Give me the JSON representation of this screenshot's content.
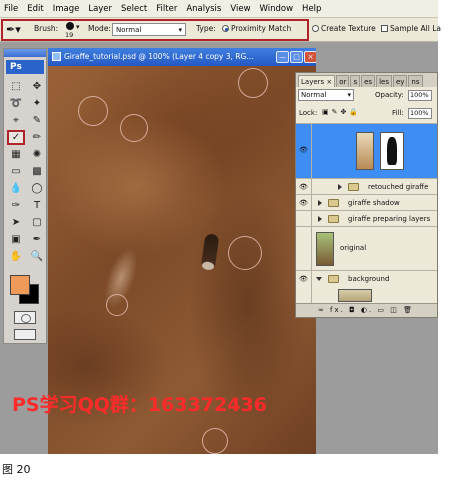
{
  "menu": [
    "File",
    "Edit",
    "Image",
    "Layer",
    "Select",
    "Filter",
    "Analysis",
    "View",
    "Window",
    "Help"
  ],
  "options": {
    "brush_label": "Brush:",
    "brush_size": "19",
    "mode_label": "Mode:",
    "mode_value": "Normal",
    "type_label": "Type:",
    "proximity_label": "Proximity Match",
    "texture_label": "Create Texture",
    "sample_label": "Sample All La"
  },
  "toolbox": {
    "logo": "Ps",
    "foreground_color": "#f09a5a",
    "background_color": "#000000"
  },
  "document": {
    "title": "Giraffe_tutorial.psd @ 100% (Layer 4 copy 3, RG...",
    "watermark": "PS学习QQ群：163372436"
  },
  "layers_panel": {
    "tabs": [
      "Layers ×",
      "or",
      "s",
      "es",
      "les",
      "ey",
      "ns"
    ],
    "blend_mode": "Normal",
    "opacity_label": "Opacity:",
    "opacity_value": "100%",
    "lock_label": "Lock:",
    "fill_label": "Fill:",
    "fill_value": "100%",
    "layers": [
      {
        "name": "",
        "type": "layer-mask",
        "active": true
      },
      {
        "name": "retouched giraffe",
        "type": "group"
      },
      {
        "name": "giraffe shadow",
        "type": "group"
      },
      {
        "name": "giraffe preparing layers",
        "type": "group"
      },
      {
        "name": "original",
        "type": "layer"
      },
      {
        "name": "background",
        "type": "group"
      }
    ],
    "bottom_icons": "∞ fx. ◘ ◐. ▭ ◫ 🗑"
  },
  "caption": "图 20"
}
